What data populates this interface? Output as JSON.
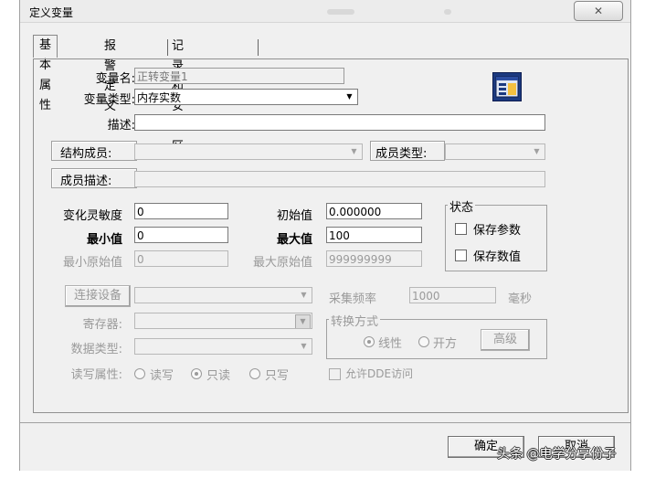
{
  "window": {
    "title": "定义变量",
    "close_label": "✕"
  },
  "tabs": [
    {
      "label": "基本属性",
      "active": true
    },
    {
      "label": "报警定义",
      "active": false
    },
    {
      "label": "记录和安全区",
      "active": false
    }
  ],
  "basic": {
    "var_name_label": "变量名:",
    "var_name_value": "正转变量1",
    "var_type_label": "变量类型:",
    "var_type_value": "内存实数",
    "desc_label": "描述:",
    "desc_value": "",
    "struct_member_label": "结构成员:",
    "struct_member_value": "",
    "member_type_label": "成员类型:",
    "member_type_value": "",
    "member_desc_label": "成员描述:",
    "member_desc_value": ""
  },
  "numeric": {
    "sensitivity_label": "变化灵敏度",
    "sensitivity_value": "0",
    "initial_label": "初始值",
    "initial_value": "0.000000",
    "min_label": "最小值",
    "min_value": "0",
    "max_label": "最大值",
    "max_value": "100",
    "min_raw_label": "最小原始值",
    "min_raw_value": "0",
    "max_raw_label": "最大原始值",
    "max_raw_value": "999999999"
  },
  "status_group": {
    "title": "状态",
    "save_params_label": "保存参数",
    "save_params_checked": false,
    "save_values_label": "保存数值",
    "save_values_checked": false
  },
  "io": {
    "connect_device_label": "连接设备",
    "connect_device_value": "",
    "sample_rate_label": "采集频率",
    "sample_rate_value": "1000",
    "sample_rate_unit": "毫秒",
    "register_label": "寄存器:",
    "register_value": "",
    "data_type_label": "数据类型:",
    "data_type_value": "",
    "rw_label": "读写属性:",
    "rw_options": [
      "读写",
      "只读",
      "只写"
    ],
    "rw_selected": "只读",
    "conversion_title": "转换方式",
    "conversion_options": [
      "线性",
      "开方"
    ],
    "conversion_selected": "线性",
    "advanced_label": "高级",
    "dde_label": "允许DDE访问"
  },
  "footer": {
    "ok_label": "确定",
    "cancel_label": "取消"
  },
  "watermark": "头条 @电学分享份子"
}
